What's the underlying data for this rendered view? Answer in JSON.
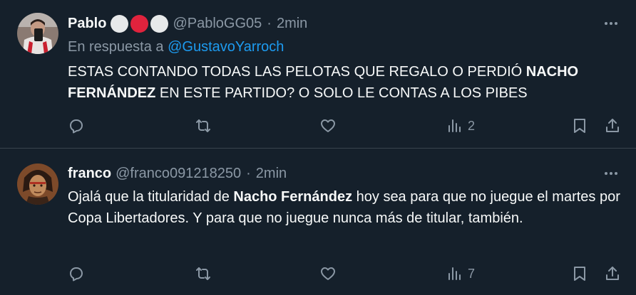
{
  "tweets": [
    {
      "display_name": "Pablo",
      "badges": [
        "white",
        "red",
        "white"
      ],
      "handle": "@PabloGG05",
      "separator": "·",
      "time": "2min",
      "reply_prefix": "En respuesta a",
      "reply_mention": "@GustavoYarroch",
      "text_parts": [
        "ESTAS CONTANDO TODAS LAS PELOTAS QUE REGALO O PERDIÓ ",
        "NACHO FERNÁNDEZ",
        " EN ESTE PARTIDO? O SOLO LE CONTAS A LOS PIBES"
      ],
      "views": "2",
      "icons": [
        "reply-icon",
        "retweet-icon",
        "like-icon",
        "views-icon",
        "bookmark-icon",
        "share-icon",
        "more-icon"
      ]
    },
    {
      "display_name": "franco",
      "handle": "@franco091218250",
      "separator": "·",
      "time": "2min",
      "text_parts": [
        "Ojalá que la titularidad de ",
        "Nacho Fernández",
        " hoy sea para que no juegue el martes por Copa Libertadores. Y para que no juegue nunca más de titular, también."
      ],
      "views": "7",
      "icons": [
        "reply-icon",
        "retweet-icon",
        "like-icon",
        "views-icon",
        "bookmark-icon",
        "share-icon",
        "more-icon"
      ]
    }
  ],
  "colors": {
    "background": "#15202b",
    "text": "#f7f9f9",
    "secondary": "#8b98a5",
    "link": "#1d9bf0",
    "divider": "#38444d"
  }
}
